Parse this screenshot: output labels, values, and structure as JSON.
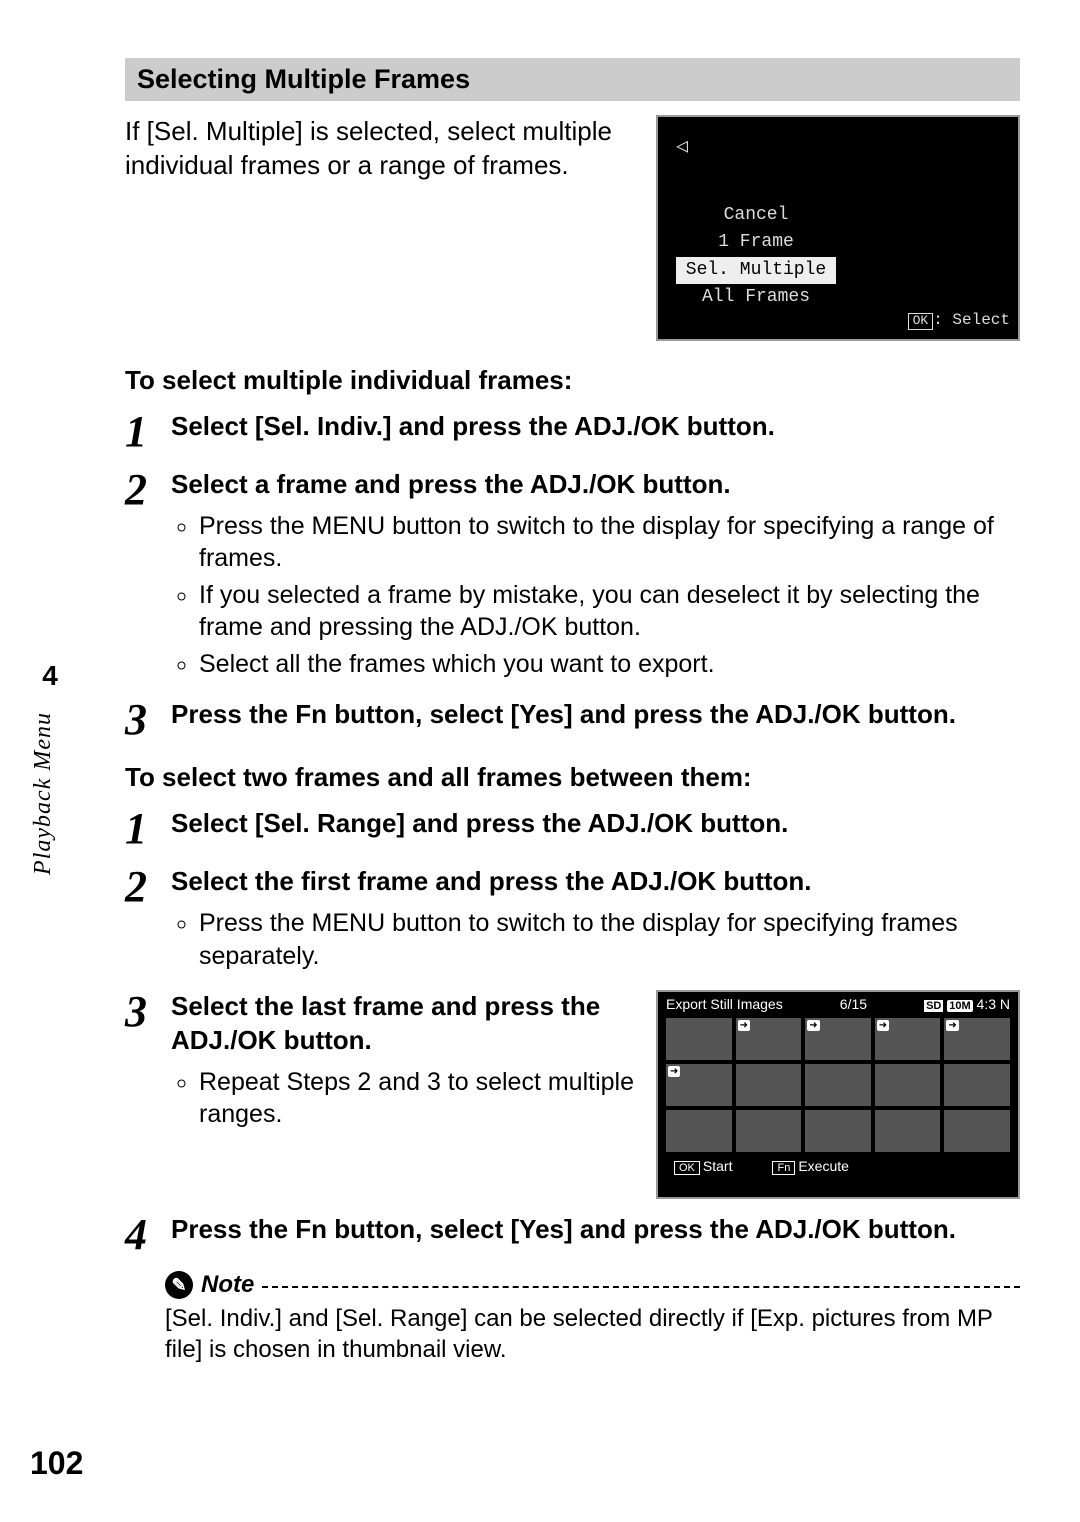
{
  "section_title": "Selecting Multiple Frames",
  "intro": "If [Sel. Multiple] is selected, select multiple individual frames or a range of frames.",
  "lcd1_menu": [
    "Cancel",
    "1 Frame",
    "Sel. Multiple",
    "All Frames"
  ],
  "lcd1_ok": ": Select",
  "lcd1_ok_btn": "OK",
  "subhead_a": "To select multiple individual frames:",
  "steps_a": [
    {
      "n": "1",
      "title": "Select [Sel. Indiv.] and press the ADJ./OK button."
    },
    {
      "n": "2",
      "title": "Select a frame and press the ADJ./OK button.",
      "bullets": [
        "Press the MENU button to switch to the display for specifying a range of frames.",
        "If you selected a frame by mistake, you can deselect it by selecting the frame and pressing the ADJ./OK button.",
        "Select all the frames which you want to export."
      ]
    },
    {
      "n": "3",
      "title": "Press the Fn button, select [Yes] and press the ADJ./OK button."
    }
  ],
  "subhead_b": "To select two frames and all frames between them:",
  "steps_b": [
    {
      "n": "1",
      "title": "Select [Sel. Range] and press the ADJ./OK button."
    },
    {
      "n": "2",
      "title": "Select the first frame and press the ADJ./OK button.",
      "bullets": [
        "Press the MENU button to switch to the display for specifying frames separately."
      ]
    },
    {
      "n": "3",
      "title": "Select the last frame and press the ADJ./OK button.",
      "bullets": [
        "Repeat Steps 2 and 3 to select multiple ranges."
      ]
    },
    {
      "n": "4",
      "title": "Press the Fn button, select [Yes] and press the ADJ./OK button."
    }
  ],
  "lcd2": {
    "title": "Export Still Images",
    "count": "6/15",
    "sd": "SD",
    "res": "10M",
    "ratio": "4:3 N",
    "ok_btn": "OK",
    "ok_label": "Start",
    "fn_btn": "Fn",
    "fn_label": "Execute"
  },
  "note_label": "Note",
  "note_body": "[Sel. Indiv.] and [Sel. Range] can be selected directly if [Exp. pictures from MP file] is chosen in thumbnail view.",
  "chapter": "4",
  "side_label": "Playback Menu",
  "page_number": "102"
}
